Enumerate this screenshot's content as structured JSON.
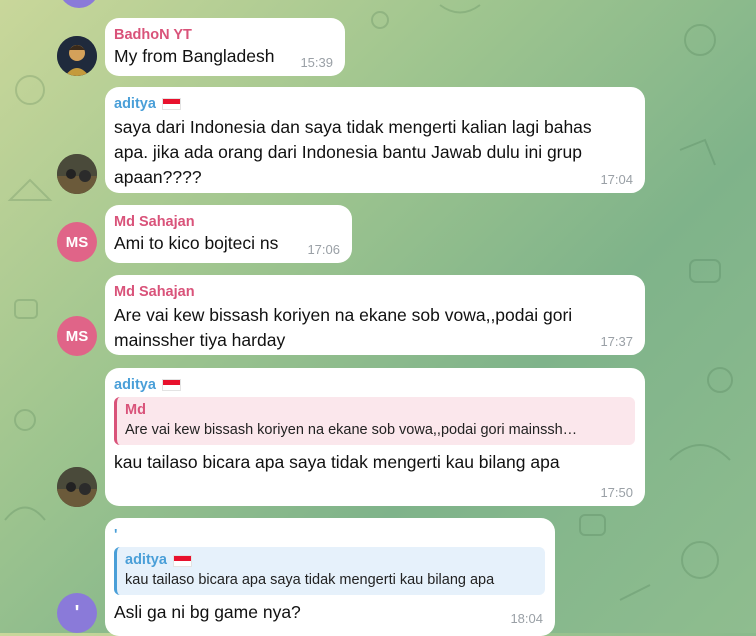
{
  "colors": {
    "red_name": "#d9537a",
    "blue_name": "#4a9fd8",
    "ms_avatar": "#e06488",
    "purple_avatar": "#8a7ad9",
    "time": "#9aa0a6"
  },
  "messages": [
    {
      "sender": "BadhoN YT",
      "text": "My from Bangladesh",
      "time": "15:39"
    },
    {
      "sender": "aditya",
      "flag": "indonesia-flag",
      "lines": [
        "saya dari Indonesia dan saya tidak mengerti kalian lagi bahas",
        "apa. jika ada orang dari Indonesia bantu Jawab dulu ini grup",
        "apaan????"
      ],
      "time": "17:04"
    },
    {
      "sender": "Md Sahajan",
      "avatar_initials": "MS",
      "text": "Ami to kico bojteci ns",
      "time": "17:06"
    },
    {
      "sender": "Md Sahajan",
      "avatar_initials": "MS",
      "lines": [
        "Are vai kew bissash koriyen na ekane sob vowa,,podai gori",
        "mainssher tiya harday"
      ],
      "time": "17:37"
    },
    {
      "sender": "aditya",
      "flag": "indonesia-flag",
      "reply": {
        "name": "Md",
        "text": "Are vai kew bissash koriyen na ekane sob vowa,,podai gori mainssh…"
      },
      "text": "kau tailaso bicara apa saya tidak mengerti kau bilang apa",
      "time": "17:50"
    },
    {
      "sender": "'",
      "avatar_initials": "'",
      "reply": {
        "name": "aditya",
        "flag": "indonesia-flag",
        "text": "kau tailaso bicara apa saya tidak mengerti kau bilang apa"
      },
      "text": "Asli ga ni bg game nya?",
      "time": "18:04"
    }
  ]
}
